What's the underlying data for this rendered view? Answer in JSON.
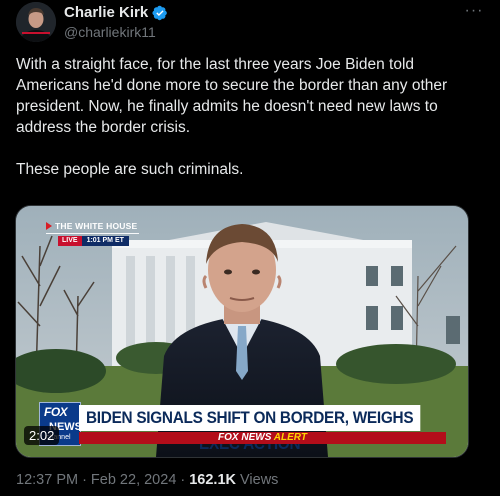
{
  "author": {
    "display_name": "Charlie Kirk",
    "handle": "@charliekirk11",
    "verified_color": "#1d9bf0"
  },
  "more_icon": "···",
  "tweet": {
    "paragraphs": [
      "With a straight face, for the last three years Joe Biden told Americans he'd done more to secure the border than any other president. Now, he finally admits he doesn't need new laws to address the border crisis.",
      "These people are such criminals."
    ]
  },
  "media": {
    "location_tag": "THE WHITE HOUSE",
    "live_label": "LIVE",
    "live_time": "1:01 PM ET",
    "logo_top": "FOX",
    "logo_mid": "NEWS",
    "logo_bottom": "channel",
    "headline": "BIDEN SIGNALS SHIFT ON BORDER, WEIGHS EXEC ACTION",
    "alert_prefix": "FOX NEWS",
    "alert_word": "ALERT",
    "duration": "2:02"
  },
  "footer": {
    "time": "12:37 PM",
    "separator": "·",
    "date": "Feb 22, 2024",
    "views_count": "162.1K",
    "views_label": "Views"
  }
}
